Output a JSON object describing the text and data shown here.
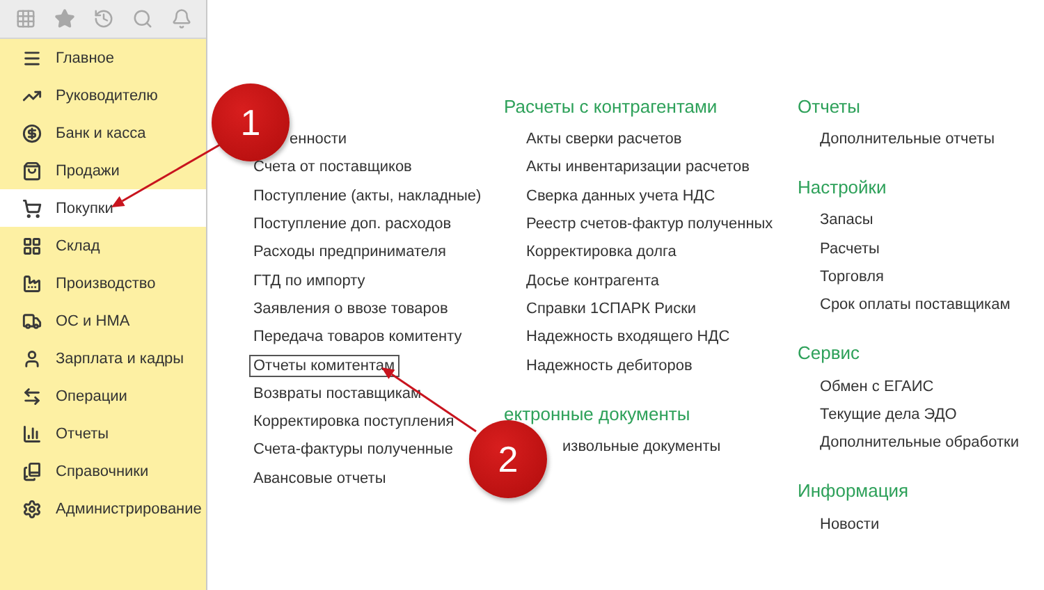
{
  "sidebar": {
    "items": [
      {
        "label": "Главное",
        "selected": false
      },
      {
        "label": "Руководителю",
        "selected": false
      },
      {
        "label": "Банк и касса",
        "selected": false
      },
      {
        "label": "Продажи",
        "selected": false
      },
      {
        "label": "Покупки",
        "selected": true
      },
      {
        "label": "Склад",
        "selected": false
      },
      {
        "label": "Производство",
        "selected": false
      },
      {
        "label": "ОС и НМА",
        "selected": false
      },
      {
        "label": "Зарплата и кадры",
        "selected": false
      },
      {
        "label": "Операции",
        "selected": false
      },
      {
        "label": "Отчеты",
        "selected": false
      },
      {
        "label": "Справочники",
        "selected": false
      },
      {
        "label": "Администрирование",
        "selected": false
      }
    ]
  },
  "columns": [
    {
      "sections": [
        {
          "items": [
            {
              "label": "енности",
              "focused": false,
              "cut": true
            },
            {
              "label": "Счета от поставщиков",
              "focused": false
            },
            {
              "label": "Поступление (акты, накладные)",
              "focused": false
            },
            {
              "label": "Поступление доп. расходов",
              "focused": false
            },
            {
              "label": "Расходы предпринимателя",
              "focused": false
            },
            {
              "label": "ГТД по импорту",
              "focused": false
            },
            {
              "label": "Заявления о ввозе товаров",
              "focused": false
            },
            {
              "label": "Передача товаров комитенту",
              "focused": false
            },
            {
              "label": "Отчеты комитентам",
              "focused": true
            },
            {
              "label": "Возвраты поставщикам",
              "focused": false
            },
            {
              "label": "Корректировка поступления",
              "focused": false
            },
            {
              "label": "Счета-фактуры полученные",
              "focused": false
            },
            {
              "label": "Авансовые отчеты",
              "focused": false
            }
          ]
        }
      ]
    },
    {
      "sections": [
        {
          "title": "Расчеты с контрагентами",
          "items": [
            {
              "label": "Акты сверки расчетов",
              "focused": false
            },
            {
              "label": "Акты инвентаризации расчетов",
              "focused": false
            },
            {
              "label": "Сверка данных учета НДС",
              "focused": false
            },
            {
              "label": "Реестр счетов-фактур полученных",
              "focused": false
            },
            {
              "label": "Корректировка долга",
              "focused": false
            },
            {
              "label": "Досье контрагента",
              "focused": false
            },
            {
              "label": "Справки 1СПАРК Риски",
              "focused": false
            },
            {
              "label": "Надежность входящего НДС",
              "focused": false
            },
            {
              "label": "Надежность дебиторов",
              "focused": false
            }
          ]
        },
        {
          "title": "ектронные документы",
          "items": [
            {
              "label": "извольные документы",
              "focused": false,
              "cut": true
            }
          ]
        }
      ]
    },
    {
      "sections": [
        {
          "title": "Отчеты",
          "items": [
            {
              "label": "Дополнительные отчеты",
              "focused": false
            }
          ]
        },
        {
          "title": "Настройки",
          "items": [
            {
              "label": "Запасы",
              "focused": false
            },
            {
              "label": "Расчеты",
              "focused": false
            },
            {
              "label": "Торговля",
              "focused": false
            },
            {
              "label": "Срок оплаты поставщикам",
              "focused": false
            }
          ]
        },
        {
          "title": "Сервис",
          "items": [
            {
              "label": "Обмен с ЕГАИС",
              "focused": false
            },
            {
              "label": "Текущие дела ЭДО",
              "focused": false
            },
            {
              "label": "Дополнительные обработки",
              "focused": false
            }
          ]
        },
        {
          "title": "Информация",
          "items": [
            {
              "label": "Новости",
              "focused": false
            }
          ]
        }
      ]
    }
  ],
  "annotations": [
    {
      "label": "1"
    },
    {
      "label": "2"
    }
  ]
}
